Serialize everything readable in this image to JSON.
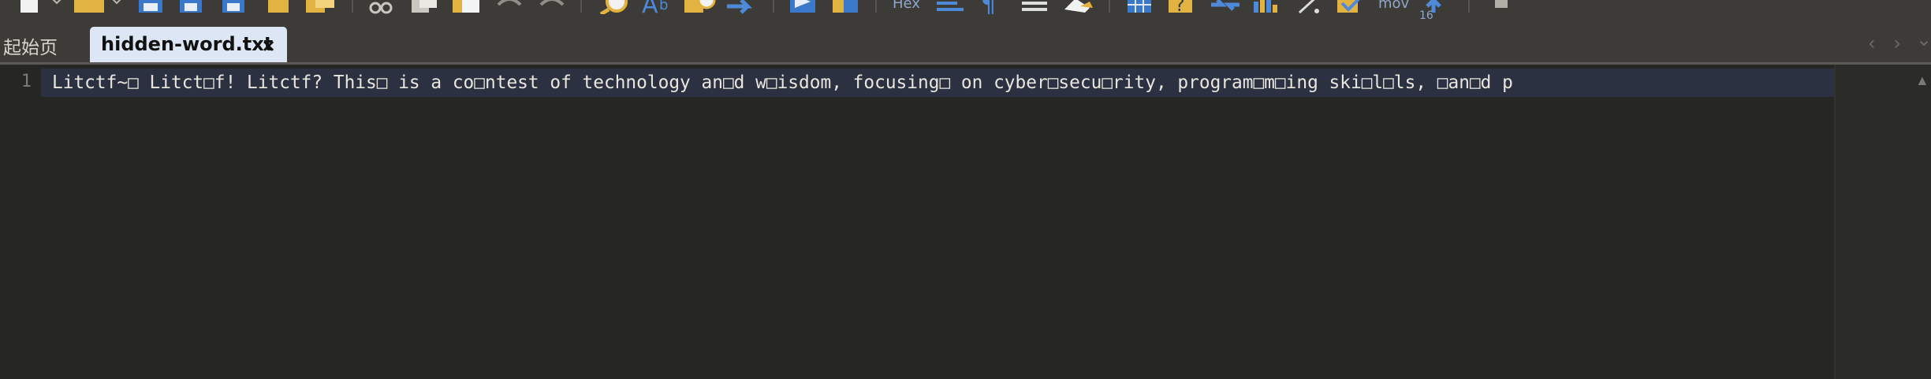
{
  "toolbar": {
    "hex_label": "Hex",
    "mov_label": "mov",
    "num16_label": "16",
    "icons": [
      "new-file-icon",
      "open-folder-icon",
      "save-icon",
      "save-all-icon",
      "save-as-icon",
      "paste-clipboard-icon",
      "copy-files-icon",
      "cut-icon",
      "copy-icon",
      "paste-icon",
      "undo-icon",
      "redo-icon",
      "find-icon",
      "replace-icon",
      "find-in-files-icon",
      "goto-icon",
      "macro-icon",
      "macro-run-icon",
      "hex-icon",
      "word-wrap-icon",
      "show-symbols-icon",
      "indent-guide-icon",
      "eraser-icon",
      "column-mode-icon",
      "help-icon",
      "sync-scroll-icon",
      "chart-icon",
      "math-icon",
      "check-icon",
      "mov-icon",
      "stop-icon"
    ]
  },
  "tabs": {
    "start_page": "起始页",
    "active": "hidden-word.txt",
    "close_glyph": "×",
    "nav_left": "‹",
    "nav_right": "›",
    "nav_menu": "⌄"
  },
  "editor": {
    "line_number": "1",
    "line_text": "Litctf~□ Litct□f! Litctf? This□ is a co□ntest of technology an□d w□isdom, focusing□ on cyber□secu□rity, program□m□ing ski□l□ls, □an□d p"
  },
  "colors": {
    "background": "#262624",
    "toolbar": "#3c3b37",
    "active_tab": "#dce6f4",
    "current_line": "#2b3140",
    "text": "#e8e6de"
  }
}
